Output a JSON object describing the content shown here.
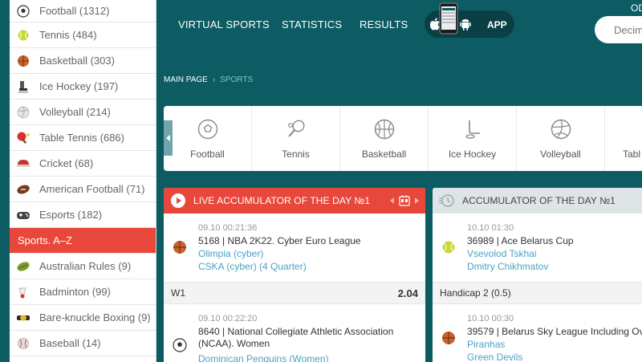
{
  "sidebar": {
    "items": [
      {
        "label": "Football (1312)",
        "icon": "football-icon"
      },
      {
        "label": "Tennis (484)",
        "icon": "tennis-ball-icon"
      },
      {
        "label": "Basketball (303)",
        "icon": "basketball-icon"
      },
      {
        "label": "Ice Hockey (197)",
        "icon": "ice-hockey-icon"
      },
      {
        "label": "Volleyball (214)",
        "icon": "volleyball-icon"
      },
      {
        "label": "Table Tennis (686)",
        "icon": "table-tennis-icon"
      },
      {
        "label": "Cricket (68)",
        "icon": "cricket-icon"
      },
      {
        "label": "American Football (71)",
        "icon": "american-football-icon"
      },
      {
        "label": "Esports (182)",
        "icon": "gamepad-icon"
      }
    ],
    "az_label": "Sports. A–Z",
    "az_items": [
      {
        "label": "Australian Rules (9)",
        "icon": "australian-rules-icon"
      },
      {
        "label": "Badminton (99)",
        "icon": "shuttlecock-icon"
      },
      {
        "label": "Bare-knuckle Boxing (9)",
        "icon": "boxing-belt-icon"
      },
      {
        "label": "Baseball (14)",
        "icon": "baseball-icon"
      }
    ]
  },
  "topnav": {
    "virtual_sports": "VIRTUAL SPORTS",
    "statistics": "STATISTICS",
    "results": "RESULTS",
    "app": "APP",
    "odds_label": "OD",
    "odds_value": "Decim"
  },
  "breadcrumb": {
    "main": "MAIN PAGE",
    "separator": "›",
    "current": "SPORTS"
  },
  "sports_strip": [
    {
      "label": "Football"
    },
    {
      "label": "Tennis"
    },
    {
      "label": "Basketball"
    },
    {
      "label": "Ice Hockey"
    },
    {
      "label": "Volleyball"
    },
    {
      "label": "Tabl"
    }
  ],
  "card1": {
    "title": "LIVE ACCUMULATOR OF THE DAY №1",
    "events": [
      {
        "time": "09.10 00:21:36",
        "league": "5168 | NBA 2K22. Cyber Euro League",
        "team1": "Olimpia (cyber)",
        "team2": "CSKA (cyber) (4 Quarter)"
      },
      {
        "time": "09.10 00:22:20",
        "league": "8640 | National Collegiate Athletic Association (NCAA). Women",
        "team1": "Dominican Penguins (Women)"
      }
    ],
    "bet_label": "W1",
    "bet_odd": "2.04"
  },
  "card2": {
    "title": "ACCUMULATOR OF THE DAY №1",
    "events": [
      {
        "time": "10.10 01:30",
        "league": "36989 | Ace Belarus Cup",
        "team1": "Vsevolod Tskhai",
        "team2": "Dmitry Chikhmatov"
      },
      {
        "time": "10.10 00:30",
        "league": "39579 | Belarus Sky League Including Ov",
        "team1": "Piranhas",
        "team2": "Green Devils"
      }
    ],
    "bet_label": "Handicap 2 (0.5)"
  },
  "colors": {
    "background": "#0d5c63",
    "accent_red": "#e8473b",
    "link_blue": "#4aa3c4"
  }
}
